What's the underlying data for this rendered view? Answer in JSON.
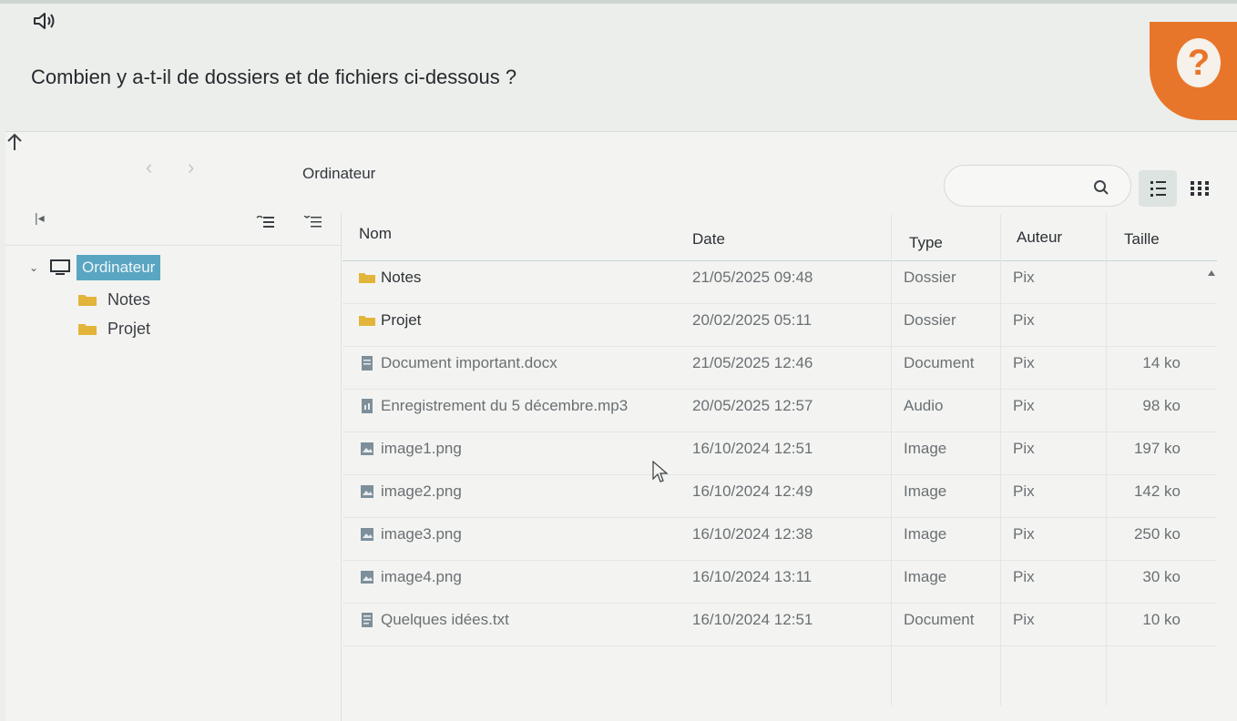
{
  "question": "Combien y a-t-il de dossiers et de fichiers ci-dessous ?",
  "help_badge": "?",
  "toolbar": {
    "back": "‹",
    "forward": "›",
    "path": "Ordinateur"
  },
  "sidebar": {
    "collapse": "|◂",
    "root_label": "Ordinateur",
    "items": [
      {
        "label": "Notes"
      },
      {
        "label": "Projet"
      }
    ]
  },
  "columns": {
    "name": "Nom",
    "date": "Date",
    "type": "Type",
    "author": "Auteur",
    "size": "Taille"
  },
  "rows": [
    {
      "name": "Notes",
      "date": "21/05/2025 09:48",
      "type": "Dossier",
      "author": "Pix",
      "size": "",
      "icon": "folder-icon"
    },
    {
      "name": "Projet",
      "date": "20/02/2025 05:11",
      "type": "Dossier",
      "author": "Pix",
      "size": "",
      "icon": "folder-icon"
    },
    {
      "name": "Document important.docx",
      "date": "21/05/2025 12:46",
      "type": "Document",
      "author": "Pix",
      "size": "14 ko",
      "icon": "document-icon"
    },
    {
      "name": "Enregistrement du 5 décembre.mp3",
      "date": "20/05/2025 12:57",
      "type": "Audio",
      "author": "Pix",
      "size": "98 ko",
      "icon": "audio-icon"
    },
    {
      "name": "image1.png",
      "date": "16/10/2024 12:51",
      "type": "Image",
      "author": "Pix",
      "size": "197 ko",
      "icon": "image-icon"
    },
    {
      "name": "image2.png",
      "date": "16/10/2024 12:49",
      "type": "Image",
      "author": "Pix",
      "size": "142 ko",
      "icon": "image-icon"
    },
    {
      "name": "image3.png",
      "date": "16/10/2024 12:38",
      "type": "Image",
      "author": "Pix",
      "size": "250 ko",
      "icon": "image-icon"
    },
    {
      "name": "image4.png",
      "date": "16/10/2024 13:11",
      "type": "Image",
      "author": "Pix",
      "size": "30 ko",
      "icon": "image-icon"
    },
    {
      "name": "Quelques idées.txt",
      "date": "16/10/2024 12:51",
      "type": "Document",
      "author": "Pix",
      "size": "10 ko",
      "icon": "text-file-icon"
    }
  ],
  "colors": {
    "accent_orange": "#e8762a",
    "selection_blue": "#5aa5c2",
    "folder_yellow": "#e2b43a"
  }
}
